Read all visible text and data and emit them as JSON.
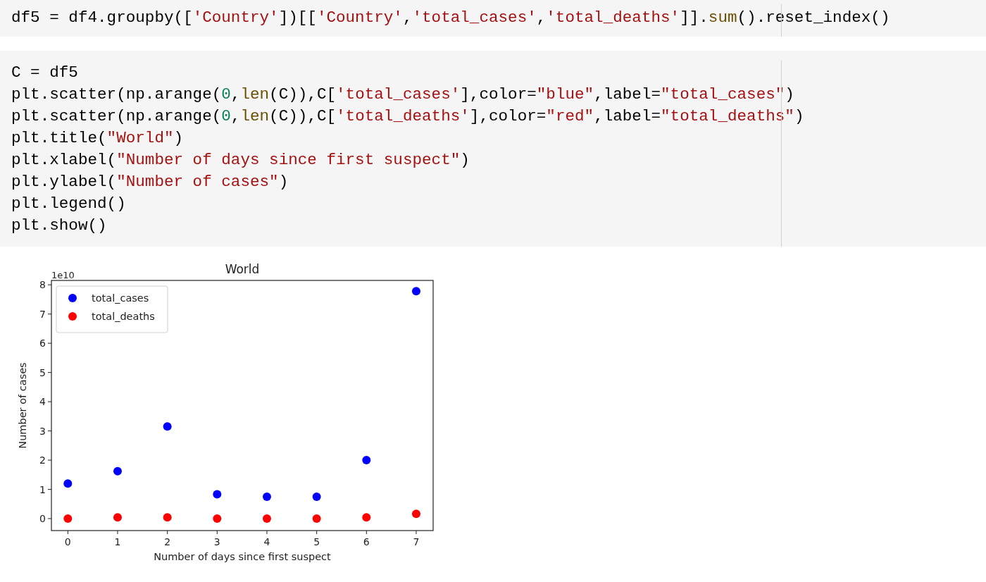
{
  "cells": [
    {
      "lines": [
        [
          {
            "kind": "plain",
            "text": "df5 = df4.groupby(["
          },
          {
            "kind": "string",
            "text": "'Country'"
          },
          {
            "kind": "plain",
            "text": "])[["
          },
          {
            "kind": "string",
            "text": "'Country'"
          },
          {
            "kind": "plain",
            "text": ","
          },
          {
            "kind": "string",
            "text": "'total_cases'"
          },
          {
            "kind": "plain",
            "text": ","
          },
          {
            "kind": "string",
            "text": "'total_deaths'"
          },
          {
            "kind": "plain",
            "text": "]]."
          },
          {
            "kind": "builtin",
            "text": "sum"
          },
          {
            "kind": "plain",
            "text": "().reset_index()"
          }
        ]
      ]
    },
    {
      "lines": [
        [
          {
            "kind": "plain",
            "text": "C = df5"
          }
        ],
        [
          {
            "kind": "plain",
            "text": "plt.scatter(np.arange("
          },
          {
            "kind": "number",
            "text": "0"
          },
          {
            "kind": "plain",
            "text": ","
          },
          {
            "kind": "builtin",
            "text": "len"
          },
          {
            "kind": "plain",
            "text": "(C)),C["
          },
          {
            "kind": "string",
            "text": "'total_cases'"
          },
          {
            "kind": "plain",
            "text": "],color="
          },
          {
            "kind": "string",
            "text": "\"blue\""
          },
          {
            "kind": "plain",
            "text": ",label="
          },
          {
            "kind": "string",
            "text": "\"total_cases\""
          },
          {
            "kind": "plain",
            "text": ")"
          }
        ],
        [
          {
            "kind": "plain",
            "text": "plt.scatter(np.arange("
          },
          {
            "kind": "number",
            "text": "0"
          },
          {
            "kind": "plain",
            "text": ","
          },
          {
            "kind": "builtin",
            "text": "len"
          },
          {
            "kind": "plain",
            "text": "(C)),C["
          },
          {
            "kind": "string",
            "text": "'total_deaths'"
          },
          {
            "kind": "plain",
            "text": "],color="
          },
          {
            "kind": "string",
            "text": "\"red\""
          },
          {
            "kind": "plain",
            "text": ",label="
          },
          {
            "kind": "string",
            "text": "\"total_deaths\""
          },
          {
            "kind": "plain",
            "text": ")"
          }
        ],
        [
          {
            "kind": "plain",
            "text": "plt.title("
          },
          {
            "kind": "string",
            "text": "\"World\""
          },
          {
            "kind": "plain",
            "text": ")"
          }
        ],
        [
          {
            "kind": "plain",
            "text": "plt.xlabel("
          },
          {
            "kind": "string",
            "text": "\"Number of days since first suspect\""
          },
          {
            "kind": "plain",
            "text": ")"
          }
        ],
        [
          {
            "kind": "plain",
            "text": "plt.ylabel("
          },
          {
            "kind": "string",
            "text": "\"Number of cases\""
          },
          {
            "kind": "plain",
            "text": ")"
          }
        ],
        [
          {
            "kind": "plain",
            "text": "plt.legend()"
          }
        ],
        [
          {
            "kind": "plain",
            "text": "plt.show()"
          }
        ]
      ]
    }
  ],
  "output": {
    "chart_data": {
      "type": "scatter",
      "title": "World",
      "xlabel": "Number of days since first suspect",
      "ylabel": "Number of cases",
      "x": [
        0,
        1,
        2,
        3,
        4,
        5,
        6,
        7
      ],
      "series": [
        {
          "name": "total_cases",
          "color": "#0000ff",
          "values": [
            1.2,
            1.62,
            3.15,
            0.83,
            0.75,
            0.75,
            2.0,
            7.78
          ]
        },
        {
          "name": "total_deaths",
          "color": "#ff0000",
          "values": [
            0.0,
            0.04,
            0.04,
            0.0,
            0.0,
            0.0,
            0.04,
            0.16
          ]
        }
      ],
      "xlim": [
        -0.33,
        7.34
      ],
      "ylim": [
        -0.41,
        8.15
      ],
      "xticks": [
        0,
        1,
        2,
        3,
        4,
        5,
        6,
        7
      ],
      "yticks": [
        0,
        1,
        2,
        3,
        4,
        5,
        6,
        7,
        8
      ],
      "annotations": [
        "1e10"
      ],
      "legend": true
    }
  }
}
